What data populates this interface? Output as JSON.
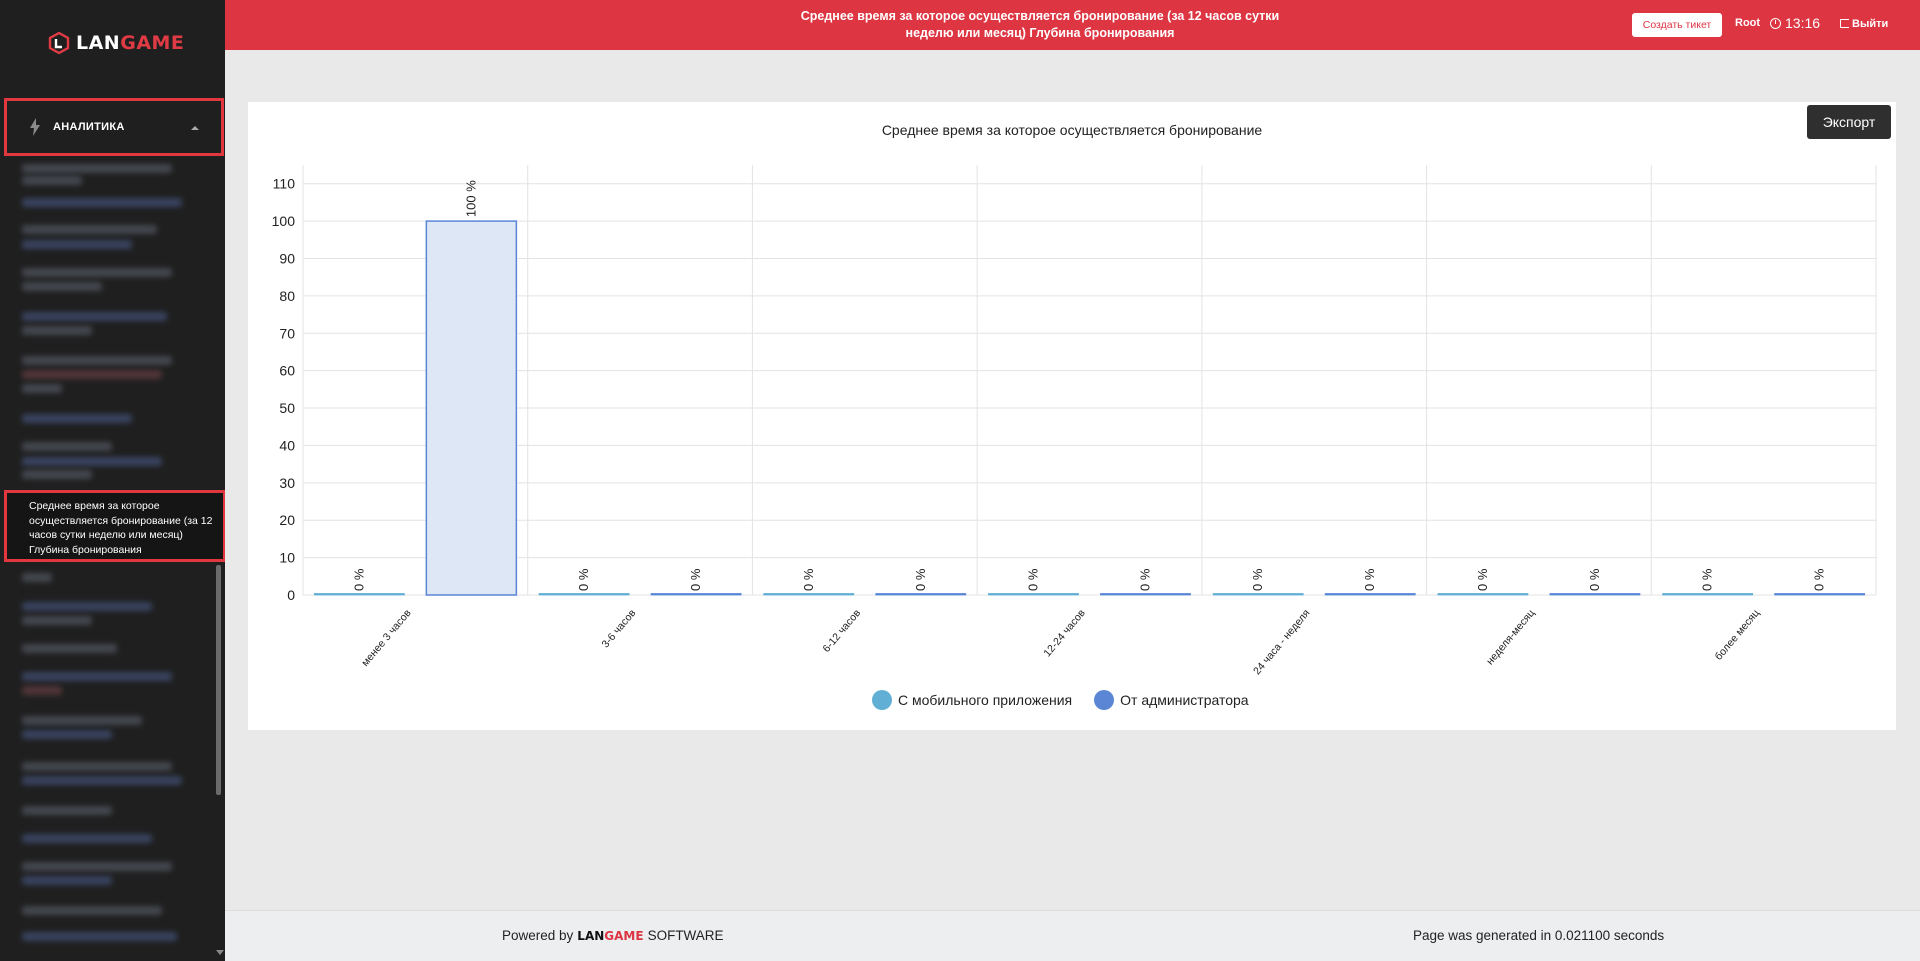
{
  "sidebar": {
    "logo": {
      "part1": "LAN",
      "part2": "GAME"
    },
    "section_label": "АНАЛИТИКА",
    "active_item": "Среднее время за которое осуществляется бронирование (за 12 часов сутки неделю или месяц) Глубина бронирования"
  },
  "topbar": {
    "title": "Среднее время за которое осуществляется бронирование (за 12 часов сутки неделю или месяц) Глубина бронирования",
    "ticket_button": "Создать тикет",
    "user": "Root",
    "time": "13:16",
    "logout": "Выйти"
  },
  "main": {
    "export_button": "Экспорт"
  },
  "chart_data": {
    "type": "bar",
    "title": "Среднее время за которое осуществляется бронирование",
    "categories": [
      "менее 3 часов",
      "3-6 часов",
      "6-12 часов",
      "12-24 часов",
      "24 часа - неделя",
      "неделя-месяц",
      "более месяц"
    ],
    "series": [
      {
        "name": "С мобильного приложения",
        "values": [
          0,
          0,
          0,
          0,
          0,
          0,
          0
        ],
        "color": "#62afd6"
      },
      {
        "name": "От администратора",
        "values": [
          100,
          0,
          0,
          0,
          0,
          0,
          0
        ],
        "color": "#5b86d6"
      }
    ],
    "value_suffix": " %",
    "ylim": [
      0,
      115
    ],
    "yticks": [
      0,
      10,
      20,
      30,
      40,
      50,
      60,
      70,
      80,
      90,
      100,
      110
    ],
    "legend": "bottom",
    "grid": true
  },
  "footer": {
    "powered_prefix": "Powered by",
    "brand_part1": "LAN",
    "brand_part2": "GAME",
    "powered_suffix": "SOFTWARE",
    "generated": "Page was generated in 0.021100 seconds"
  }
}
